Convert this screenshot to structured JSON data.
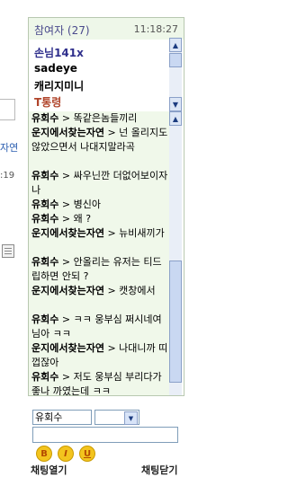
{
  "left_fragments": {
    "text1": "자연",
    "text2": ":19"
  },
  "panel": {
    "title": "참여자 (27)",
    "time": "11:18:27"
  },
  "users": [
    {
      "name": "손님141x",
      "color": "#2f2f8c"
    },
    {
      "name": "sadeye",
      "color": "#000000"
    },
    {
      "name": "캐리지미니",
      "color": "#000000"
    },
    {
      "name": "T통령",
      "color": "#b0442a"
    }
  ],
  "messages": [
    {
      "who": "유회수",
      "text": "> 똑같은놈들끼리"
    },
    {
      "who": "운지에서찾는자연",
      "text": "> 넌 올리지도않았으면서 나대지말라곡"
    },
    {
      "who": "유회수",
      "text": "> 싸우닌깐 더없어보이자나"
    },
    {
      "who": "유회수",
      "text": "> 병신아"
    },
    {
      "who": "유회수",
      "text": "> 왜 ?"
    },
    {
      "who": "운지에서찾는자연",
      "text": "> 뉴비새끼가"
    },
    {
      "who": "유회수",
      "text": "> 안올리는 유저는 티드립하면 안되 ?"
    },
    {
      "who": "운지에서찾는자연",
      "text": "> 캣창에서"
    },
    {
      "who": "유회수",
      "text": "> ㅋㅋ 웅부심 쩌시네여 님아 ㅋㅋ"
    },
    {
      "who": "운지에서찾는자연",
      "text": "> 나대니까 띠껍잖아"
    },
    {
      "who": "유회수",
      "text": "> 저도 웅부심 부리다가 좋나 까였는데 ㅋㅋ"
    }
  ],
  "input": {
    "name_value": "유회수",
    "message_value": "",
    "format_buttons": [
      "B",
      "I",
      "U"
    ]
  },
  "bottom": {
    "open_label": "채팅열기",
    "close_label": "채팅닫기"
  }
}
